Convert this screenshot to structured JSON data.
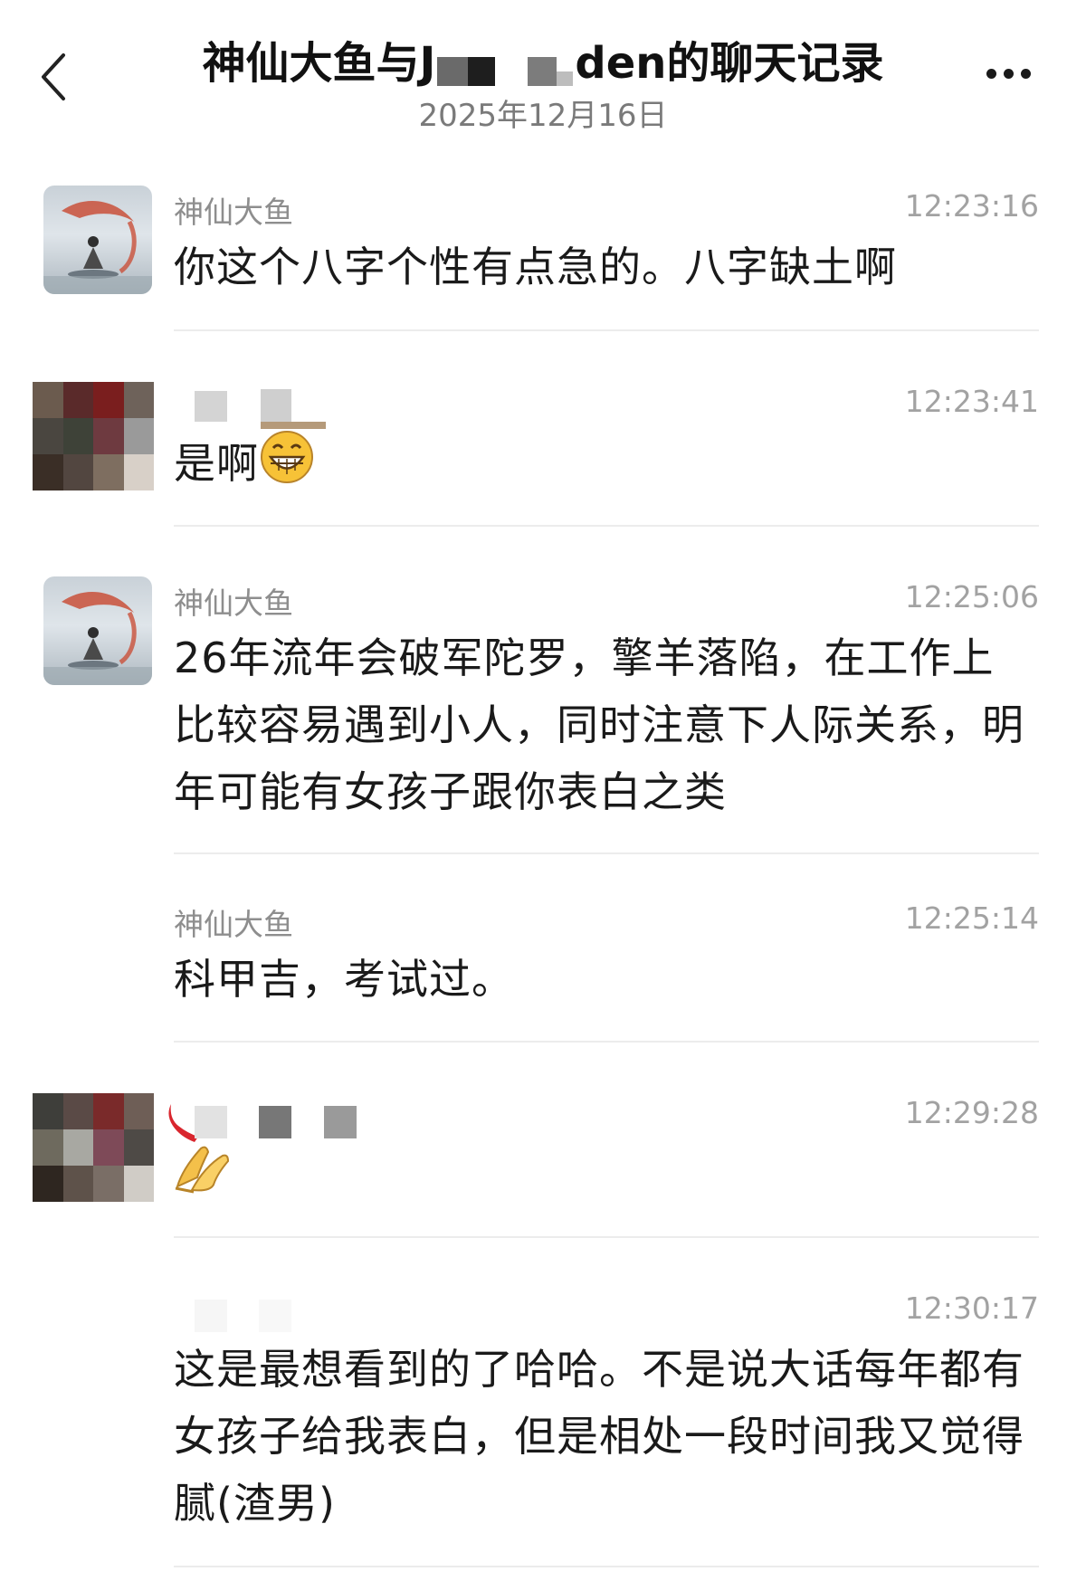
{
  "header": {
    "title_prefix": "神仙大鱼与J",
    "title_suffix": "den的聊天记录",
    "date": "2025年12月16日",
    "back_icon": "chevron-left-icon",
    "more_icon": "more-dots-icon"
  },
  "messages": [
    {
      "sender": "神仙大鱼",
      "time": "12:23:16",
      "text": "你这个八字个性有点急的。八字缺土啊",
      "avatar": "fairy-avatar"
    },
    {
      "sender": "",
      "time": "12:23:41",
      "text": "是啊",
      "emoji": "grinning-face-icon",
      "avatar": "blurred-avatar"
    },
    {
      "sender": "神仙大鱼",
      "time": "12:25:06",
      "text": "26年流年会破军陀罗，擎羊落陷，在工作上比较容易遇到小人，同时注意下人际关系，明年可能有女孩子跟你表白之类",
      "avatar": "fairy-avatar"
    },
    {
      "sender": "神仙大鱼",
      "time": "12:25:14",
      "text": "科甲吉，考试过。"
    },
    {
      "sender": "",
      "time": "12:29:28",
      "text": "",
      "emoji": "folded-hands-icon",
      "avatar": "blurred-avatar"
    },
    {
      "sender": "",
      "time": "12:30:17",
      "text": "这是最想看到的了哈哈。不是说大话每年都有女孩子给我表白，但是相处一段时间我又觉得腻(渣男)"
    }
  ]
}
